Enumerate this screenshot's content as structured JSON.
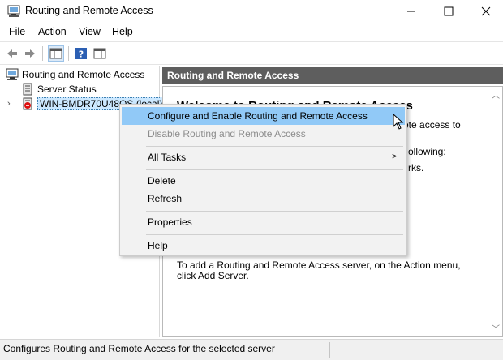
{
  "window": {
    "title": "Routing and Remote Access",
    "minimize_label": "—",
    "maximize_label": "☐",
    "close_label": "✕"
  },
  "menubar": {
    "items": [
      "File",
      "Action",
      "View",
      "Help"
    ]
  },
  "toolbar": {
    "buttons": [
      "back-icon",
      "forward-icon",
      "show-hide-tree-icon",
      "help-icon",
      "properties-icon"
    ]
  },
  "tree": {
    "root": "Routing and Remote Access",
    "server_status": "Server Status",
    "server": "WIN-BMDR70U48QS (local)"
  },
  "right_pane": {
    "header": "Routing and Remote Access",
    "welcome_title": "Welcome to Routing and Remote Access",
    "partial_line1": "ote access to",
    "partial_line2": "ollowing:",
    "partial_line3": "rks.",
    "bottom_text_line1": "To add a Routing and Remote Access server, on the Action menu,",
    "bottom_text_line2": "click Add Server."
  },
  "context_menu": {
    "configure": "Configure and Enable Routing and Remote Access",
    "disable": "Disable Routing and Remote Access",
    "all_tasks": "All Tasks",
    "delete": "Delete",
    "refresh": "Refresh",
    "properties": "Properties",
    "help": "Help"
  },
  "statusbar": {
    "text": "Configures Routing and Remote Access for the selected server"
  },
  "colors": {
    "highlight": "#91c9f7",
    "header_bg": "#5e5e5e",
    "selection": "#cce8ff"
  }
}
